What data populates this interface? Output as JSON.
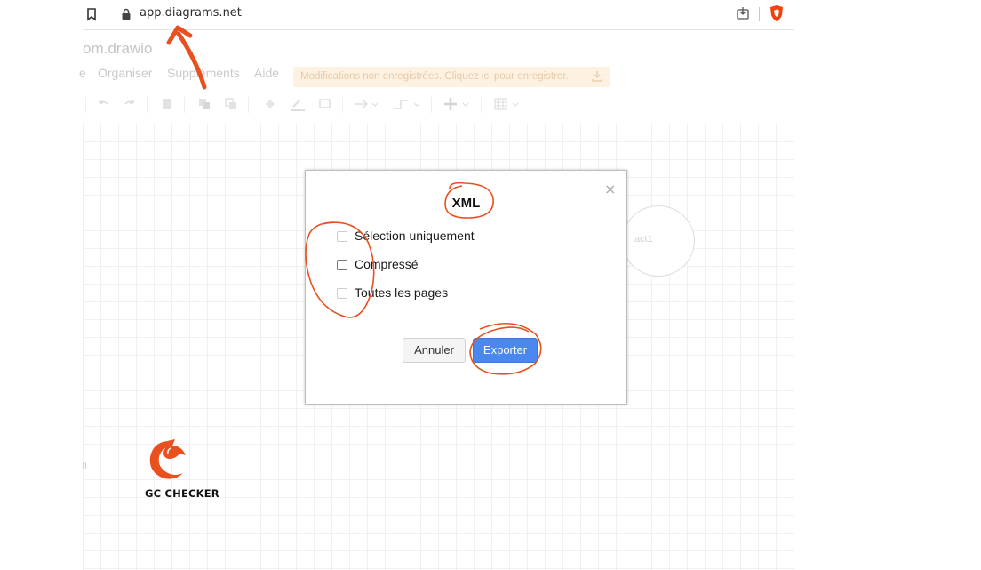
{
  "browser": {
    "url": "app.diagrams.net"
  },
  "app": {
    "title": "om.drawio",
    "menu": [
      {
        "label": "e"
      },
      {
        "label": "Organiser"
      },
      {
        "label": "Suppléments"
      },
      {
        "label": "Aide"
      }
    ],
    "unsaved_banner": "Modifications non enregistrées. Cliquez ici pour enregistrer.",
    "canvas_shape_label": "act1"
  },
  "dialog": {
    "title": "XML",
    "close_symbol": "×",
    "options": [
      {
        "label": "Sélection uniquement",
        "checked": false,
        "enabled": false
      },
      {
        "label": "Compressé",
        "checked": false,
        "enabled": true
      },
      {
        "label": "Toutes les pages",
        "checked": false,
        "enabled": false
      }
    ],
    "cancel_label": "Annuler",
    "export_label": "Exporter"
  },
  "watermark": {
    "brand": "GC CHECKER"
  },
  "colors": {
    "annotation": "#e8501e",
    "primary_button": "#4a87ee",
    "brave": "#f2420e",
    "logo": "#e8501e"
  }
}
